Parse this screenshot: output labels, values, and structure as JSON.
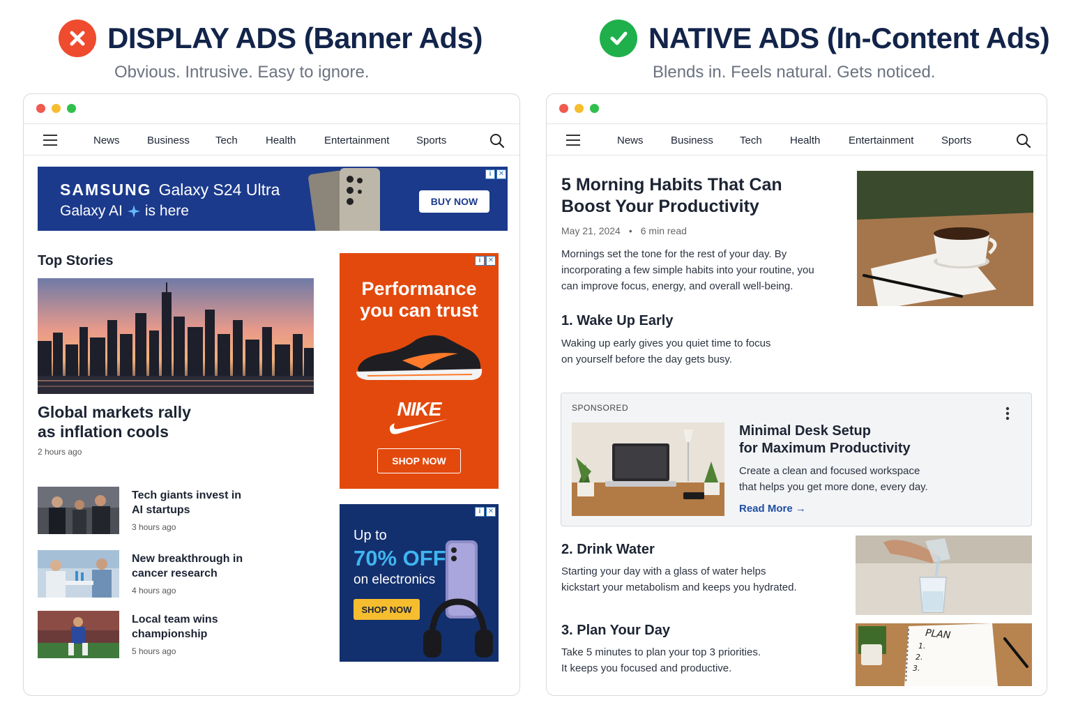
{
  "left_panel": {
    "title": "DISPLAY ADS (Banner Ads)",
    "subtitle": "Obvious. Intrusive. Easy to ignore.",
    "badge_icon": "x-circle-icon",
    "badge_color": "#ef4b2f",
    "nav": {
      "items": [
        "News",
        "Business",
        "Tech",
        "Health",
        "Entertainment",
        "Sports"
      ]
    },
    "banner_ad": {
      "brand": "SAMSUNG",
      "product": "Galaxy S24 Ultra",
      "line2_a": "Galaxy AI",
      "line2_b": "is here",
      "cta": "BUY NOW",
      "bg_color": "#1b3a8c"
    },
    "top_stories_heading": "Top Stories",
    "featured": {
      "title_line1": "Global markets rally",
      "title_line2": "as inflation cools",
      "time": "2 hours ago"
    },
    "stories": [
      {
        "title_line1": "Tech giants invest in",
        "title_line2": "AI startups",
        "time": "3 hours ago"
      },
      {
        "title_line1": "New breakthrough in",
        "title_line2": "cancer research",
        "time": "4 hours ago"
      },
      {
        "title_line1": "Local team wins",
        "title_line2": "championship",
        "time": "5 hours ago"
      }
    ],
    "side_ad_1": {
      "line1": "Performance",
      "line2": "you can trust",
      "brand": "NIKE",
      "cta": "SHOP NOW",
      "bg_color": "#e3490d"
    },
    "side_ad_2": {
      "line1": "Up to",
      "line2": "70% OFF",
      "line3": "on electronics",
      "cta": "SHOP NOW",
      "bg_color": "#13306e",
      "accent": "#3fb6f0"
    }
  },
  "right_panel": {
    "title": "NATIVE ADS (In-Content Ads)",
    "subtitle": "Blends in. Feels natural. Gets noticed.",
    "badge_icon": "check-circle-icon",
    "badge_color": "#1fb04b",
    "nav": {
      "items": [
        "News",
        "Business",
        "Tech",
        "Health",
        "Entertainment",
        "Sports"
      ]
    },
    "article": {
      "title_line1": "5 Morning Habits That Can",
      "title_line2": "Boost Your Productivity",
      "date": "May 21, 2024",
      "separator": "•",
      "read_time": "6 min read",
      "intro_line1": "Mornings set the tone for the rest of your day. By",
      "intro_line2": "incorporating a few simple habits into your routine, you",
      "intro_line3": "can improve focus, energy, and overall well-being.",
      "habit1_title": "1. Wake Up Early",
      "habit1_line1": "Waking up early gives you quiet time to focus",
      "habit1_line2": "on yourself before the day gets busy.",
      "habit2_title": "2. Drink Water",
      "habit2_line1": "Starting your day with a glass of water helps",
      "habit2_line2": "kickstart your metabolism and keeps you hydrated.",
      "habit3_title": "3. Plan Your Day",
      "habit3_line1": "Take 5 minutes to plan your top 3 priorities.",
      "habit3_line2": "It keeps you focused and productive."
    },
    "sponsored": {
      "label": "SPONSORED",
      "title_line1": "Minimal Desk Setup",
      "title_line2": "for Maximum Productivity",
      "desc_line1": "Create a clean and focused workspace",
      "desc_line2": "that helps you get more done, every day.",
      "link": "Read More →",
      "link_color": "#1f4ea3"
    },
    "plan_note": {
      "heading": "PLAN",
      "items": [
        "1.",
        "2.",
        "3."
      ]
    }
  }
}
